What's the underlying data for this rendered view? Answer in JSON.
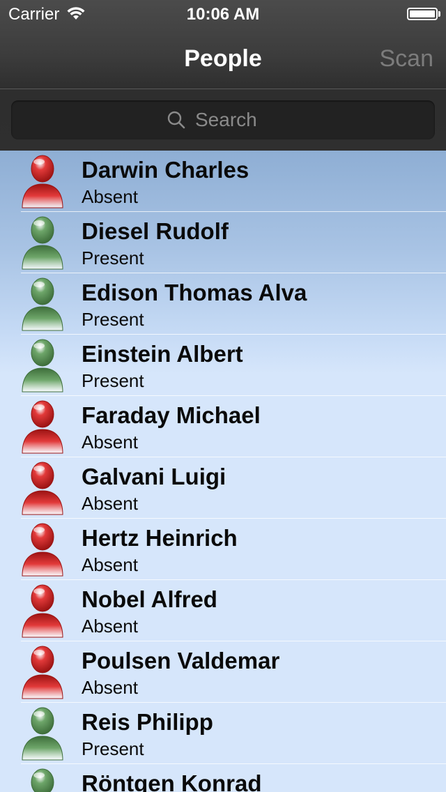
{
  "status_bar": {
    "carrier": "Carrier",
    "time": "10:06 AM"
  },
  "nav": {
    "title": "People",
    "scan_label": "Scan"
  },
  "search": {
    "placeholder": "Search",
    "value": ""
  },
  "colors": {
    "absent": "#e23a3a",
    "present": "#6ea66a"
  },
  "people": [
    {
      "name": "Darwin Charles",
      "status": "Absent",
      "icon": "person-red-icon"
    },
    {
      "name": "Diesel Rudolf",
      "status": "Present",
      "icon": "person-green-icon"
    },
    {
      "name": "Edison Thomas Alva",
      "status": "Present",
      "icon": "person-green-icon"
    },
    {
      "name": "Einstein Albert",
      "status": "Present",
      "icon": "person-green-icon"
    },
    {
      "name": "Faraday Michael",
      "status": "Absent",
      "icon": "person-red-icon"
    },
    {
      "name": "Galvani Luigi",
      "status": "Absent",
      "icon": "person-red-icon"
    },
    {
      "name": "Hertz Heinrich",
      "status": "Absent",
      "icon": "person-red-icon"
    },
    {
      "name": "Nobel Alfred",
      "status": "Absent",
      "icon": "person-red-icon"
    },
    {
      "name": "Poulsen Valdemar",
      "status": "Absent",
      "icon": "person-red-icon"
    },
    {
      "name": "Reis Philipp",
      "status": "Present",
      "icon": "person-green-icon"
    },
    {
      "name": "Röntgen Konrad",
      "status": "",
      "icon": "person-green-icon"
    }
  ]
}
